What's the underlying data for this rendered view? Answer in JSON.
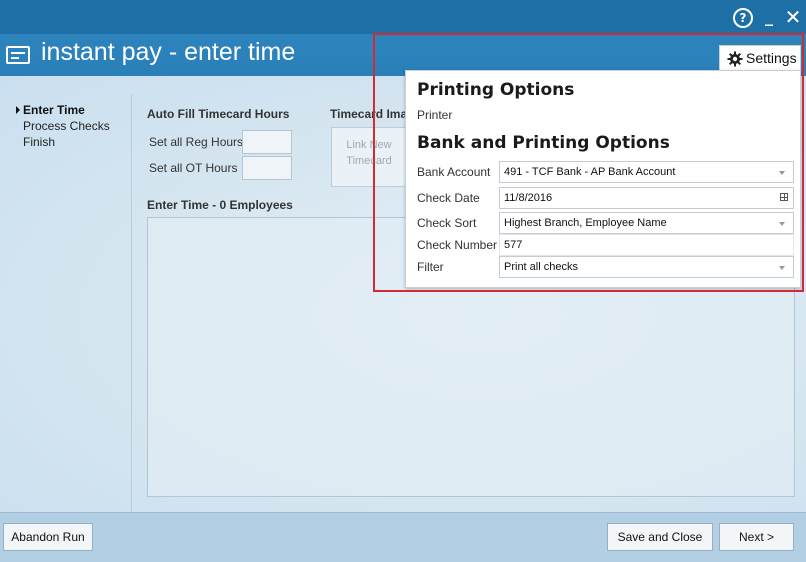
{
  "window": {
    "title": "instant pay - enter time",
    "controls": {
      "help": "?",
      "minimize": "_",
      "close": "✕"
    }
  },
  "steps": [
    {
      "label": "Enter Time",
      "active": true
    },
    {
      "label": "Process Checks",
      "active": false
    },
    {
      "label": "Finish",
      "active": false
    }
  ],
  "autofill": {
    "title": "Auto Fill Timecard Hours",
    "reg_label": "Set all Reg Hours",
    "ot_label": "Set all OT Hours"
  },
  "timecard": {
    "title": "Timecard Ima",
    "link_label": "Link New Timecard"
  },
  "enter_time": {
    "title": "Enter Time - 0 Employees"
  },
  "footer": {
    "abandon": "Abandon Run",
    "save_close": "Save and Close",
    "next": "Next >"
  },
  "settings": {
    "tab_label": "Settings",
    "printing_title": "Printing Options",
    "printer_label": "Printer",
    "bank_title": "Bank and Printing Options",
    "bank_account_label": "Bank Account",
    "bank_account_value": "491 - TCF Bank - AP Bank Account",
    "check_date_label": "Check Date",
    "check_date_value": "11/8/2016",
    "check_sort_label": "Check Sort",
    "check_sort_value": "Highest Branch, Employee Name",
    "check_number_label": "Check Number",
    "check_number_value": "577",
    "filter_label": "Filter",
    "filter_value": "Print all checks"
  },
  "colors": {
    "titlebar": "#1e6fa6",
    "header": "#2a7fb8",
    "highlight": "#d42a33"
  }
}
